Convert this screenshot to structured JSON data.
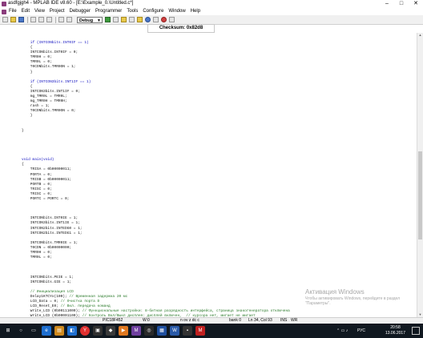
{
  "window": {
    "title": "asdfgjgh4 - MPLAB IDE v8.60 - [E:\\Example_0.\\Untitled.c*]",
    "buttons": [
      "–",
      "□",
      "✕"
    ]
  },
  "menubar": {
    "items": [
      "File",
      "Edit",
      "View",
      "Project",
      "Debugger",
      "Programmer",
      "Tools",
      "Configure",
      "Window",
      "Help"
    ]
  },
  "toolbar": {
    "build_config": "Debug"
  },
  "checksum": {
    "label": "Checksum:  0x82d8"
  },
  "code": {
    "lines": [
      "    if (INTCONbits.INT0IF == 1)",
      "    {",
      "    INTCONbits.INT0IF = 0;",
      "    TMR0H = 0;",
      "    TMR0L = 0;",
      "    T0CONbits.TMR0ON = 1;",
      "    }",
      "",
      "    if (INTCON3bits.INT1IF == 1)",
      "    {",
      "    INTCON3bits.INT1IF = 0;",
      "    mg_TMR0L = TMR0L;",
      "    mg_TMR0H = TMR0H;",
      "    rash = 1;",
      "    T0CONbits.TMR0ON = 0;",
      "    }",
      "",
      "",
      "}",
      "",
      "",
      "",
      "",
      "",
      "void main(void)",
      "{",
      "    TRISA = 0b00000011;",
      "    PORTA = 0;",
      "    TRISB = 0b00000011;",
      "    PORTB = 0;",
      "    TRISC = 0;",
      "    TRISC = 0;",
      "    PORTC = PORTC = 0;",
      "",
      "",
      "",
      "    INTCONbits.INT0IE = 1;",
      "    INTCON3bits.INT1IE = 1;",
      "    INTCON2bits.INTEDG0 = 1;",
      "    INTCON2bits.INTEDG1 = 1;",
      "",
      "    INTCONbits.TMR0IE = 1;",
      "    T0CON = 0b00000000;",
      "    TMR0H = 0;",
      "    TMR0L = 0;",
      "",
      "",
      "",
      "    INTCONbits.PEIE = 1;",
      "    INTCONbits.GIE = 1;",
      "",
      "    // Инициализация LCD",
      "    Delay1KTCYx(100); // Временная задержка 20 мс",
      "    LCD_Data = 0; // Очистка порта D",
      "    LCD_Reset_E0; // Вкл. передача команд",
      "    Write_LCD (0b00111000); // Функциональные настройки: 8-битная разрядность интерфейса, страница знакогенератора отключена",
      "    Write_LCD (0b00001100); // Контроль Вкл/Выкл дисплея: дисплей включен,  // курсора нет, мигает не мигает",
      "    Write_LCD (0b00000001); // Очистка дисплея"
    ]
  },
  "watermark": {
    "title": "Активация Windows",
    "text": "Чтобы активировать Windows, перейдите в раздел \"Параметры\"."
  },
  "statusbar": {
    "device": "PIC18F452",
    "w": "W:0",
    "flags": "n ov z dc c",
    "bank": "bank 0",
    "position": "Ln 34, Col 93",
    "ins": "INS",
    "wr": "WR"
  },
  "taskbar": {
    "language": "РУС",
    "time": "20:58",
    "date": "13.06.2017"
  }
}
